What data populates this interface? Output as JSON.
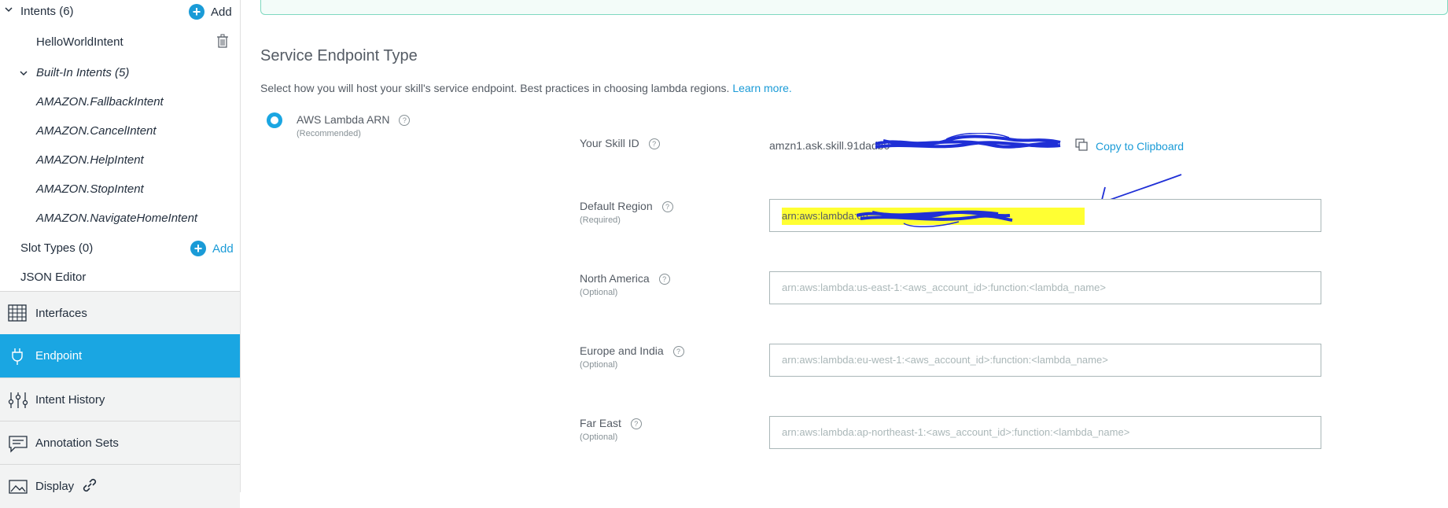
{
  "sidebar": {
    "intents_label": "Intents (6)",
    "add_label": "Add",
    "hello_world": "HelloWorldIntent",
    "builtin_label": "Built-In Intents (5)",
    "builtin_items": [
      "AMAZON.FallbackIntent",
      "AMAZON.CancelIntent",
      "AMAZON.HelpIntent",
      "AMAZON.StopIntent",
      "AMAZON.NavigateHomeIntent"
    ],
    "slot_types_label": "Slot Types (0)",
    "slot_add_label": "Add",
    "json_editor_label": "JSON Editor",
    "nav": [
      "Interfaces",
      "Endpoint",
      "Intent History",
      "Annotation Sets",
      "Display"
    ]
  },
  "main": {
    "title": "Service Endpoint Type",
    "description": "Select how you will host your skill's service endpoint. Best practices in choosing lambda regions.",
    "learn_more": "Learn more.",
    "radio_label": "AWS Lambda ARN",
    "radio_sub": "(Recommended)",
    "skill_id_label": "Your Skill ID",
    "skill_id_value": "amzn1.ask.skill.91dadb0",
    "copy_label": "Copy to Clipboard",
    "default_region_label": "Default Region",
    "default_region_sub": "(Required)",
    "default_region_value": "arn:aws:lambda:eu",
    "north_america_label": "North America",
    "north_america_sub": "(Optional)",
    "north_america_placeholder": "arn:aws:lambda:us-east-1:<aws_account_id>:function:<lambda_name>",
    "europe_label": "Europe and India",
    "europe_sub": "(Optional)",
    "europe_placeholder": "arn:aws:lambda:eu-west-1:<aws_account_id>:function:<lambda_name>",
    "far_east_label": "Far East",
    "far_east_sub": "(Optional)",
    "far_east_placeholder": "arn:aws:lambda:ap-northeast-1:<aws_account_id>:function:<lambda_name>"
  },
  "colors": {
    "accent": "#1aa6e2",
    "highlight": "#ffff33",
    "scribble": "#1f2fd6"
  }
}
